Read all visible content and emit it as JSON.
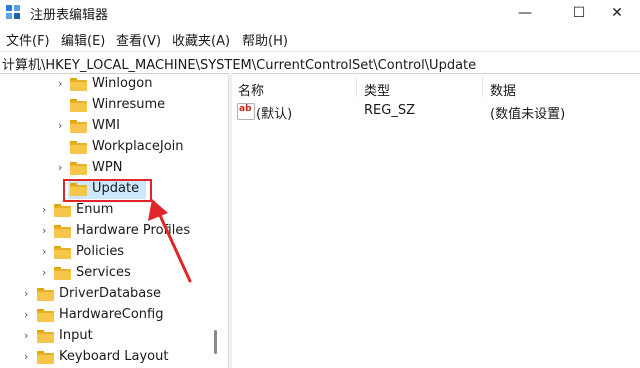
{
  "window": {
    "title": "注册表编辑器",
    "controls": {
      "minimize": "—",
      "maximize": "☐",
      "close": "✕"
    }
  },
  "menu": [
    "文件(F)",
    "编辑(E)",
    "查看(V)",
    "收藏夹(A)",
    "帮助(H)"
  ],
  "address": "计算机\\HKEY_LOCAL_MACHINE\\SYSTEM\\CurrentControlSet\\Control\\Update",
  "tree": [
    {
      "label": "Winlogon",
      "expandable": true
    },
    {
      "label": "Winresume",
      "expandable": false
    },
    {
      "label": "WMI",
      "expandable": true
    },
    {
      "label": "WorkplaceJoin",
      "expandable": false
    },
    {
      "label": "WPN",
      "expandable": true
    },
    {
      "label": "Update",
      "expandable": false,
      "selected": true
    },
    {
      "label": "Enum",
      "expandable": true
    },
    {
      "label": "Hardware Profiles",
      "expandable": true
    },
    {
      "label": "Policies",
      "expandable": true
    },
    {
      "label": "Services",
      "expandable": true
    },
    {
      "label": "DriverDatabase",
      "expandable": true
    },
    {
      "label": "HardwareConfig",
      "expandable": true
    },
    {
      "label": "Input",
      "expandable": true
    },
    {
      "label": "Keyboard Layout",
      "expandable": true
    }
  ],
  "values_table": {
    "columns": [
      "名称",
      "类型",
      "数据"
    ],
    "rows": [
      {
        "icon": "ab",
        "name": "(默认)",
        "type": "REG_SZ",
        "data": "(数值未设置)"
      }
    ]
  },
  "annotation_color": "#e0262a",
  "selection_color": "#cce8ff",
  "folder_color": "#f6c64b"
}
